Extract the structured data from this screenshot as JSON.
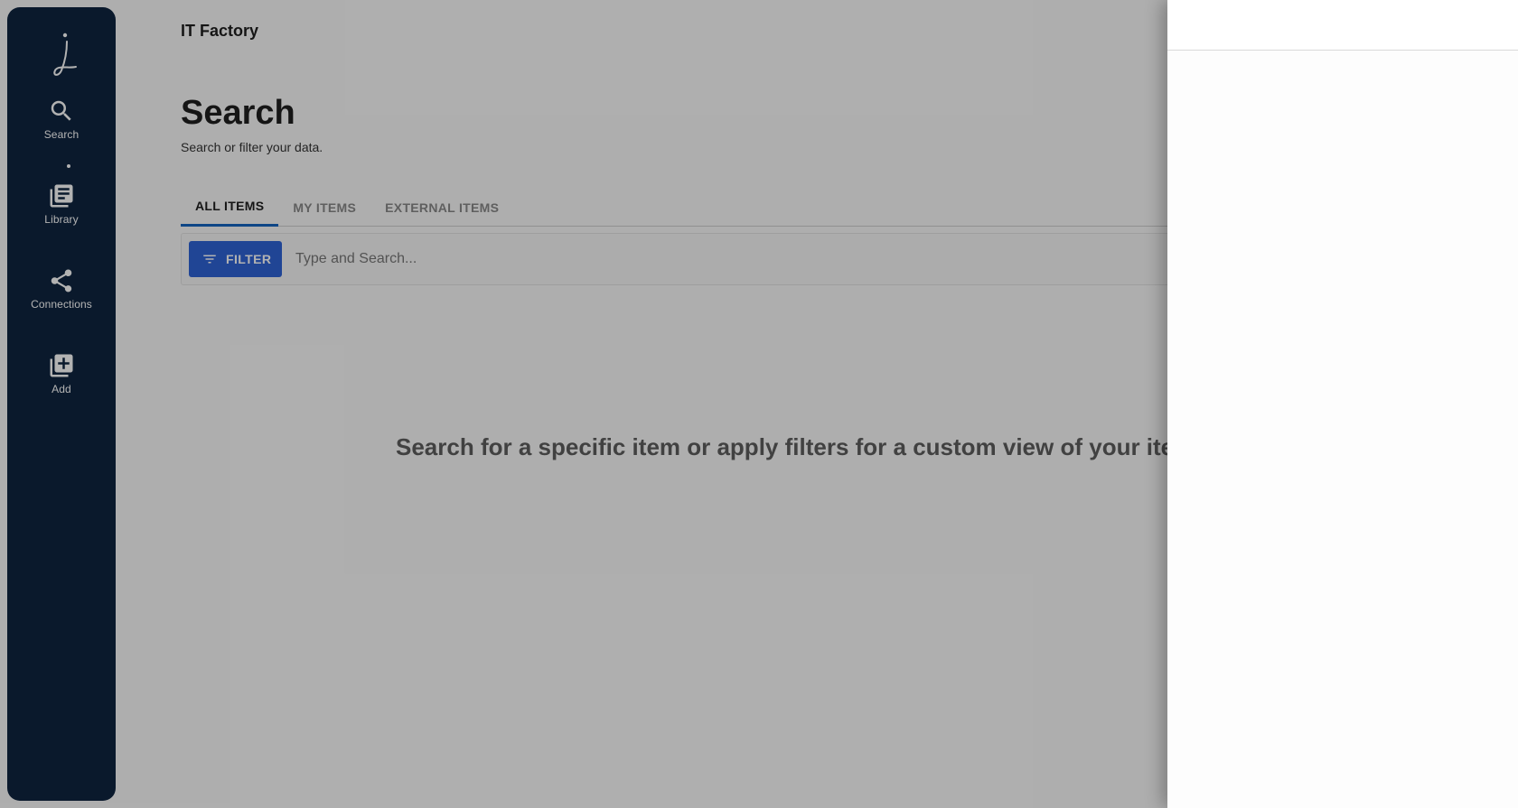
{
  "sidebar": {
    "items": [
      {
        "label": "Search",
        "icon": "search-icon"
      },
      {
        "label": "Library",
        "icon": "library-icon"
      },
      {
        "label": "Connections",
        "icon": "share-icon"
      },
      {
        "label": "Add",
        "icon": "add-box-icon"
      }
    ]
  },
  "header": {
    "org_name": "IT Factory"
  },
  "page": {
    "title": "Search",
    "subtitle": "Search or filter your data."
  },
  "tabs": [
    {
      "label": "ALL ITEMS",
      "active": true
    },
    {
      "label": "MY ITEMS",
      "active": false
    },
    {
      "label": "EXTERNAL ITEMS",
      "active": false
    }
  ],
  "search": {
    "filter_label": "FILTER",
    "placeholder": "Type and Search...",
    "value": ""
  },
  "empty_state": {
    "message": "Search for a specific item or apply filters for a custom view of your items"
  },
  "colors": {
    "sidebar": "#0f2540",
    "accent": "#2f63d6",
    "tab_indicator": "#1565c0"
  }
}
